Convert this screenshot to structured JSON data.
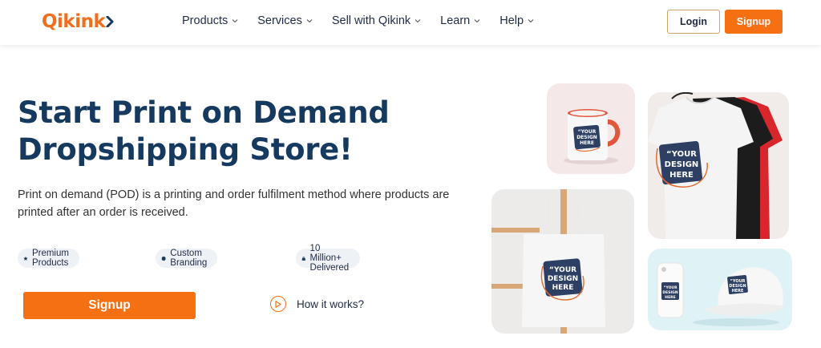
{
  "header": {
    "logo_text": "Qikink",
    "nav": [
      {
        "label": "Products"
      },
      {
        "label": "Services"
      },
      {
        "label": "Sell with Qikink"
      },
      {
        "label": "Learn"
      },
      {
        "label": "Help"
      }
    ],
    "login_label": "Login",
    "signup_label": "Signup"
  },
  "hero": {
    "title": "Start Print on Demand Dropshipping Store!",
    "description": "Print on demand (POD) is a printing and order fulfilment method where products are printed after an order is received.",
    "badges": [
      {
        "label": "Premium Products",
        "icon": "star-icon"
      },
      {
        "label": "Custom Branding",
        "icon": "badge-seal-icon"
      },
      {
        "label": "10 Million+ Delivered",
        "icon": "bag-icon"
      }
    ],
    "signup_label": "Signup",
    "how_it_works_label": "How it works?"
  },
  "products": {
    "design_text_lines": [
      "“YOUR",
      "DESIGN",
      "HERE"
    ]
  },
  "colors": {
    "brand_orange": "#f57013",
    "title_navy": "#163a5f"
  }
}
